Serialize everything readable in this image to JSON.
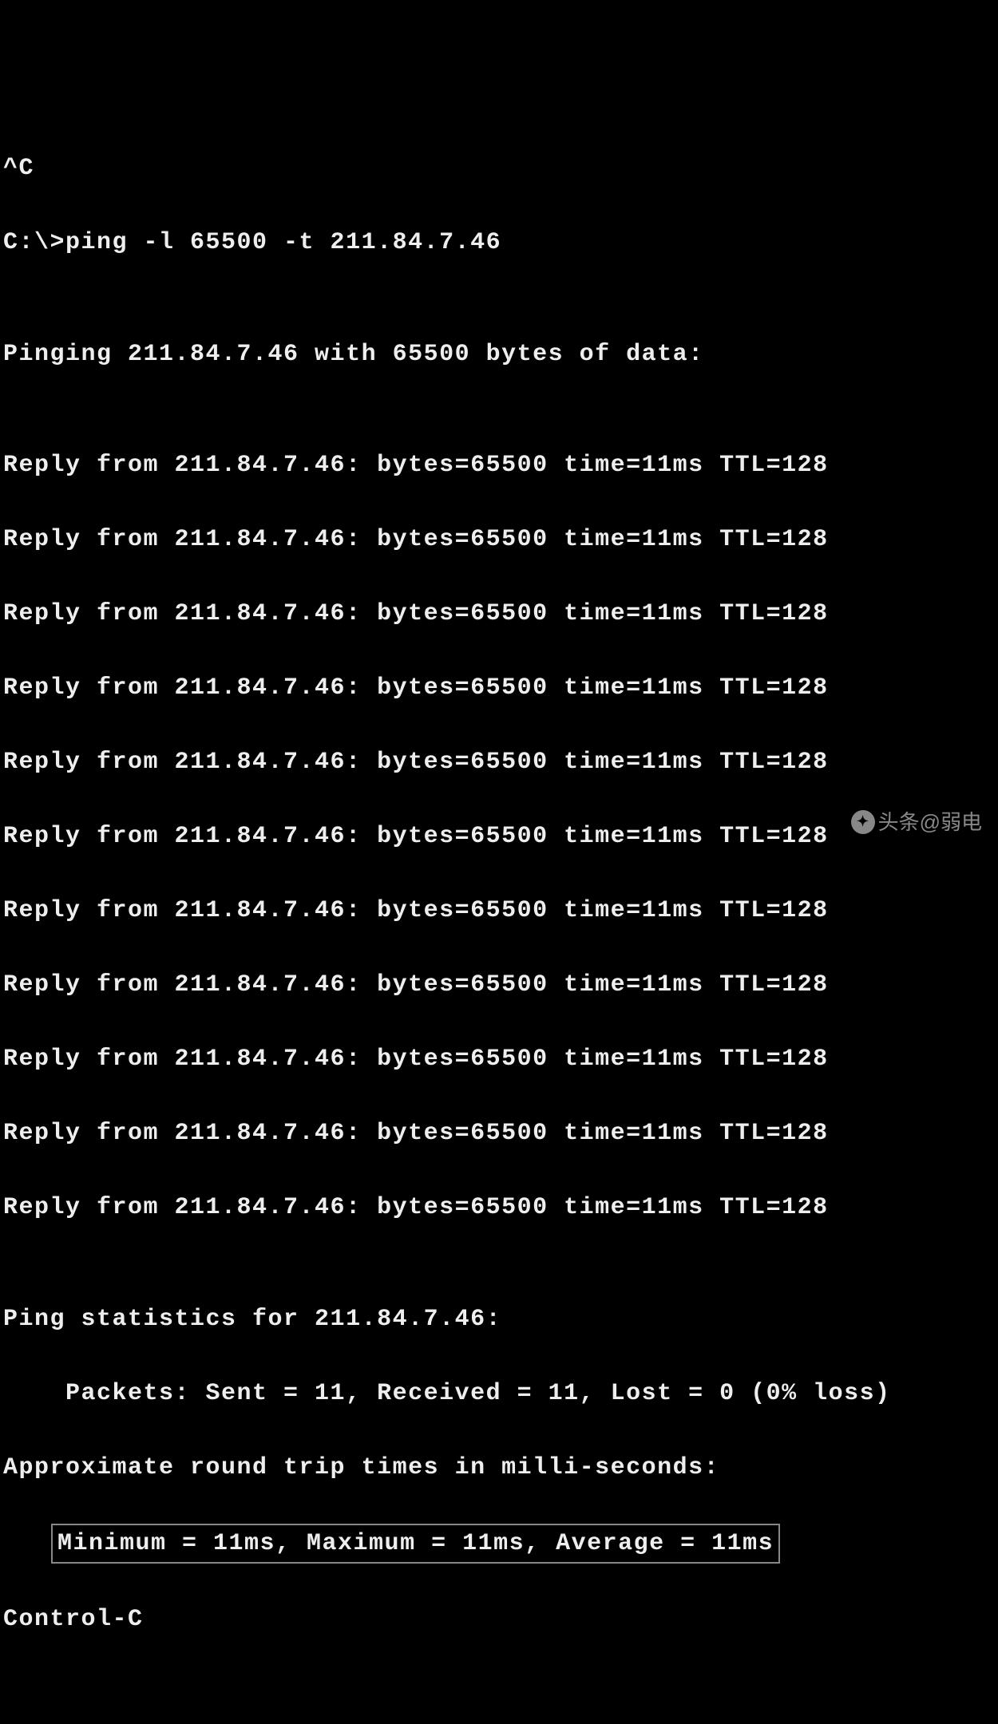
{
  "terminal": {
    "interrupt": "^C",
    "prompt": "C:\\>ping -l 65500 -t 211.84.7.46",
    "blank1": "",
    "pinging": "Pinging 211.84.7.46 with 65500 bytes of data:",
    "blank2": "",
    "replies": [
      "Reply from 211.84.7.46: bytes=65500 time=11ms TTL=128",
      "Reply from 211.84.7.46: bytes=65500 time=11ms TTL=128",
      "Reply from 211.84.7.46: bytes=65500 time=11ms TTL=128",
      "Reply from 211.84.7.46: bytes=65500 time=11ms TTL=128",
      "Reply from 211.84.7.46: bytes=65500 time=11ms TTL=128",
      "Reply from 211.84.7.46: bytes=65500 time=11ms TTL=128",
      "Reply from 211.84.7.46: bytes=65500 time=11ms TTL=128",
      "Reply from 211.84.7.46: bytes=65500 time=11ms TTL=128",
      "Reply from 211.84.7.46: bytes=65500 time=11ms TTL=128",
      "Reply from 211.84.7.46: bytes=65500 time=11ms TTL=128",
      "Reply from 211.84.7.46: bytes=65500 time=11ms TTL=128"
    ],
    "blank3": "",
    "stats_header": "Ping statistics for 211.84.7.46:",
    "packets": "    Packets: Sent = 11, Received = 11, Lost = 0 (0% loss)",
    "approx": "Approximate round trip times in milli-seconds:",
    "minmax": "Minimum = 11ms, Maximum = 11ms, Average = 11ms",
    "control_c": "Control-C"
  },
  "watermark": {
    "text": "头条@弱电"
  }
}
